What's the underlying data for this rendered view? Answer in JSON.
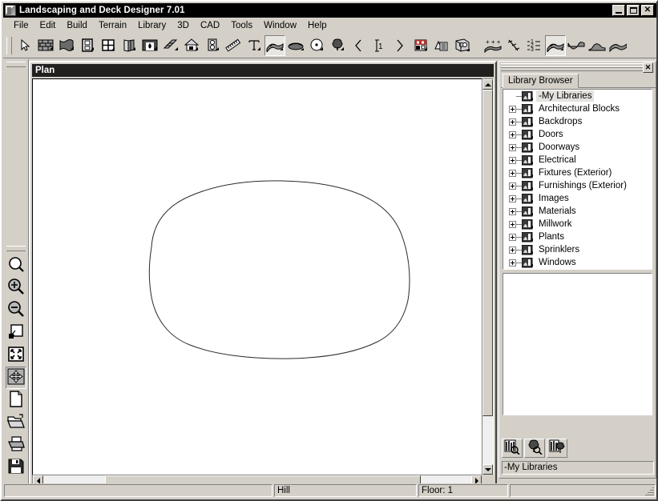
{
  "window": {
    "title": "Landscaping and Deck Designer 7.01",
    "icon": "app-document-icon",
    "buttons": [
      {
        "name": "minimize-button",
        "label": "_"
      },
      {
        "name": "maximize-button",
        "label": "□"
      },
      {
        "name": "close-button",
        "label": "✕"
      }
    ]
  },
  "menubar": {
    "items": [
      {
        "label": "File"
      },
      {
        "label": "Edit"
      },
      {
        "label": "Build"
      },
      {
        "label": "Terrain"
      },
      {
        "label": "Library"
      },
      {
        "label": "3D"
      },
      {
        "label": "CAD"
      },
      {
        "label": "Tools"
      },
      {
        "label": "Window"
      },
      {
        "label": "Help"
      }
    ]
  },
  "toolbar": {
    "buttons": [
      {
        "name": "select-tool",
        "icon": "cursor-arrow-icon",
        "active": false
      },
      {
        "name": "wall-tool",
        "icon": "brick-wall-icon",
        "active": false
      },
      {
        "name": "railing-tool",
        "icon": "curved-wall-icon",
        "active": false
      },
      {
        "name": "door-tool",
        "icon": "door-icon",
        "active": false
      },
      {
        "name": "window-tool",
        "icon": "window-icon",
        "active": false
      },
      {
        "name": "cabinet-tool",
        "icon": "cabinet-icon",
        "active": false
      },
      {
        "name": "fireplace-tool",
        "icon": "fireplace-icon",
        "active": false
      },
      {
        "name": "stairs-tool",
        "icon": "stairs-icon",
        "active": false
      },
      {
        "name": "roof-tool",
        "icon": "house-roof-icon",
        "active": false
      },
      {
        "name": "electrical-tool",
        "icon": "outlet-icon",
        "active": false
      },
      {
        "name": "dimension-tool",
        "icon": "ruler-icon",
        "active": false
      },
      {
        "name": "text-tool",
        "icon": "text-t-icon",
        "active": false
      },
      {
        "name": "terrain-perimeter-tool",
        "icon": "terrain-hill-icon",
        "active": true
      },
      {
        "name": "terrain-feature-tool",
        "icon": "terrain-mound-icon",
        "active": false
      },
      {
        "name": "plant-circle-tool",
        "icon": "circle-dot-icon",
        "active": false
      },
      {
        "name": "plant-tool",
        "icon": "tree-icon",
        "active": false
      },
      {
        "name": "previous-floor-button",
        "icon": "chevron-left-icon",
        "active": false
      },
      {
        "name": "current-floor-button",
        "icon": "floor-number-icon",
        "active": false
      },
      {
        "name": "next-floor-button",
        "icon": "chevron-right-icon",
        "active": false
      },
      {
        "name": "camera-view-button",
        "icon": "elevation-view-icon",
        "active": false
      },
      {
        "name": "cross-section-button",
        "icon": "cross-section-icon",
        "active": false
      },
      {
        "name": "glass-house-button",
        "icon": "glass-house-icon",
        "active": false
      },
      {
        "name": "terrain-elevation-points-tool",
        "icon": "elevation-points-icon",
        "active": false
      },
      {
        "name": "elevation-line-tool",
        "icon": "elevation-line-icon",
        "active": false
      },
      {
        "name": "elevation-region-tool",
        "icon": "elevation-region-icon",
        "active": false
      },
      {
        "name": "terrain-perimeter-2-tool",
        "icon": "terrain-hill-icon",
        "active": true
      },
      {
        "name": "terrain-valley-tool",
        "icon": "terrain-valley-icon",
        "active": false
      },
      {
        "name": "terrain-hill-tool",
        "icon": "terrain-bump-icon",
        "active": false
      },
      {
        "name": "terrain-ridge-tool",
        "icon": "terrain-ridge-icon",
        "active": false
      }
    ]
  },
  "left_toolbar": {
    "buttons": [
      {
        "name": "zoom-tool",
        "icon": "magnifier-icon"
      },
      {
        "name": "zoom-in-tool",
        "icon": "magnifier-plus-icon"
      },
      {
        "name": "zoom-out-tool",
        "icon": "magnifier-minus-icon"
      },
      {
        "name": "fill-window-tool",
        "icon": "fill-window-icon"
      },
      {
        "name": "zoom-extents-tool",
        "icon": "zoom-extents-icon"
      },
      {
        "name": "pan-tool",
        "icon": "pan-move-icon",
        "active": true
      },
      {
        "name": "new-plan-button",
        "icon": "new-page-icon"
      },
      {
        "name": "open-plan-button",
        "icon": "open-folder-icon"
      },
      {
        "name": "print-button",
        "icon": "printer-icon"
      },
      {
        "name": "save-button",
        "icon": "floppy-disk-icon"
      },
      {
        "name": "help-button",
        "icon": "question-mark-icon"
      }
    ]
  },
  "plan_window": {
    "title": "Plan",
    "shape_label": "terrain-perimeter-outline",
    "scroll": {
      "vertical_thumb_pct": 83,
      "horizontal_thumb_pct": 66
    }
  },
  "library_browser": {
    "close_label": "✕",
    "tab": "Library Browser",
    "status": "-My Libraries",
    "tree": [
      {
        "label": "-My Libraries",
        "expandable": false,
        "selected": true,
        "indent": 0
      },
      {
        "label": "Architectural Blocks",
        "expandable": true,
        "selected": false,
        "indent": 0
      },
      {
        "label": "Backdrops",
        "expandable": true,
        "selected": false,
        "indent": 0
      },
      {
        "label": "Doors",
        "expandable": true,
        "selected": false,
        "indent": 0
      },
      {
        "label": "Doorways",
        "expandable": true,
        "selected": false,
        "indent": 0
      },
      {
        "label": "Electrical",
        "expandable": true,
        "selected": false,
        "indent": 0
      },
      {
        "label": "Fixtures (Exterior)",
        "expandable": true,
        "selected": false,
        "indent": 0
      },
      {
        "label": "Furnishings (Exterior)",
        "expandable": true,
        "selected": false,
        "indent": 0
      },
      {
        "label": "Images",
        "expandable": true,
        "selected": false,
        "indent": 0
      },
      {
        "label": "Materials",
        "expandable": true,
        "selected": false,
        "indent": 0
      },
      {
        "label": "Millwork",
        "expandable": true,
        "selected": false,
        "indent": 0
      },
      {
        "label": "Plants",
        "expandable": true,
        "selected": false,
        "indent": 0
      },
      {
        "label": "Sprinklers",
        "expandable": true,
        "selected": false,
        "indent": 0
      },
      {
        "label": "Windows",
        "expandable": true,
        "selected": false,
        "indent": 0
      }
    ],
    "buttons": [
      {
        "name": "library-search-button",
        "icon": "library-search-icon"
      },
      {
        "name": "plant-finder-button",
        "icon": "plant-finder-icon"
      },
      {
        "name": "library-update-button",
        "icon": "library-update-icon"
      }
    ]
  },
  "statusbar": {
    "panes": [
      {
        "name": "status-message-pane",
        "text": ""
      },
      {
        "name": "status-object-pane",
        "text": "Hill"
      },
      {
        "name": "status-floor-pane",
        "text": "Floor: 1"
      },
      {
        "name": "status-extra-pane",
        "text": ""
      }
    ]
  },
  "colors": {
    "face": "#d4d0c8",
    "titlebar": "#000000",
    "plan_titlebar": "#221f1f",
    "canvas": "#ffffff",
    "selection": "#e4e2de",
    "shadow": "#808080"
  }
}
